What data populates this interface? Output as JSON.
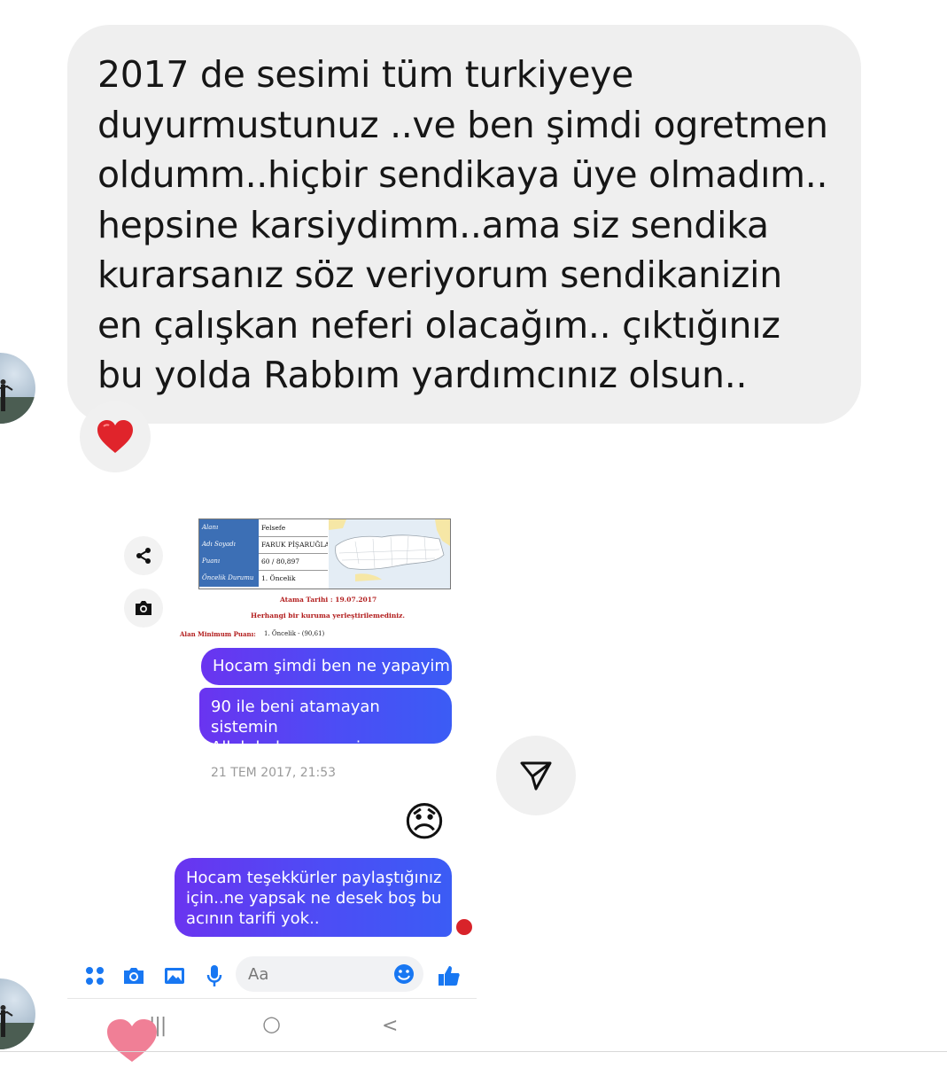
{
  "main_message": {
    "lines": [
      "2017 de sesimi tüm turkiyeye",
      "duyurmustunuz ..ve ben şimdi ogretmen",
      "oldumm..hiçbir sendikaya üye olmadım..",
      "hepsine karsiydimm..ama siz sendika",
      "kurarsanız söz veriyorum sendikanizin",
      "en çalışkan neferi olacağım.. çıktığınız",
      "bu yolda Rabbım yardımcınız olsun.."
    ],
    "reaction": "heart",
    "reaction_color": "#e0242b"
  },
  "embedded_document": {
    "rows": [
      {
        "label": "Alanı",
        "value": "Felsefe"
      },
      {
        "label": "Adı Soyadı",
        "value": "FARUK PİŞARUĞLA"
      },
      {
        "label": "Puanı",
        "value": "60 / 80,897"
      },
      {
        "label": "Öncelik Durumu",
        "value": "1. Öncelik"
      }
    ],
    "atama_tarihi": "Atama Tarihi : 19.07.2017",
    "result_text": "Herhangi bir kuruma yerleştirilemediniz.",
    "minimum_label": "Alan Minimum Puanı:",
    "minimum_value": "1. Öncelik - (90,61)"
  },
  "chat_messages": {
    "msg1": "Hocam şimdi ben ne yapayim",
    "msg2_line1": "90 ile beni atamayan sistemin",
    "msg2_line2": "Allah belasını versin",
    "timestamp": "21 TEM 2017, 21:53",
    "emoji": "😞",
    "msg3_line1": "Hocam teşekkürler paylaştığınız",
    "msg3_line2": "için..ne yapsak ne desek boş bu",
    "msg3_line3": "acının tarifi yok.."
  },
  "composer": {
    "placeholder": "Aa",
    "icons": [
      "apps-icon",
      "camera-icon",
      "gallery-icon",
      "microphone-icon",
      "emoji-icon",
      "thumbs-up-icon"
    ]
  },
  "nav_bar": {
    "recents": "|||",
    "home": "○",
    "back": "<"
  },
  "colors": {
    "bubble_gray": "#efefef",
    "messenger_gradient_start": "#6a34f0",
    "messenger_gradient_end": "#3b5cf5",
    "messenger_blue": "#1877f2"
  }
}
